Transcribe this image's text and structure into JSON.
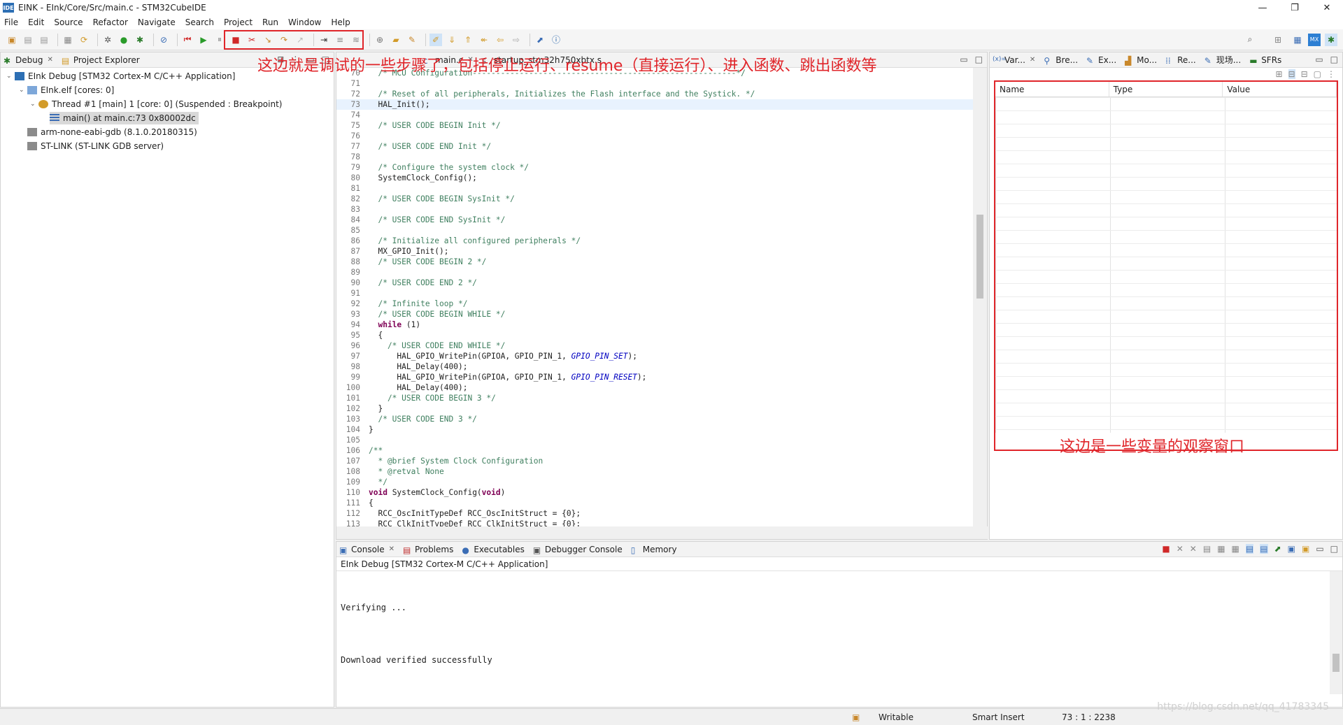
{
  "window": {
    "title": "EINK - EInk/Core/Src/main.c - STM32CubeIDE",
    "logo": "IDE",
    "minimize": "—",
    "maximize": "❐",
    "close": "✕"
  },
  "menu": [
    "File",
    "Edit",
    "Source",
    "Refactor",
    "Navigate",
    "Search",
    "Project",
    "Run",
    "Window",
    "Help"
  ],
  "annotations": {
    "toolbar_note": "这边就是调试的一些步骤了，包括停止运行、resume（直接运行）、进入函数、跳出函数等",
    "variables_note": "这边是一些变量的观察窗口",
    "highlight_color": "#e0252a"
  },
  "debug_panel": {
    "tabs": [
      "Debug",
      "Project Explorer"
    ],
    "tree": [
      {
        "label": "EInk Debug [STM32 Cortex-M C/C++ Application]",
        "icon": "ide-icon"
      },
      {
        "label": "EInk.elf [cores: 0]",
        "icon": "process-icon"
      },
      {
        "label": "Thread #1 [main] 1 [core: 0] (Suspended : Breakpoint)",
        "icon": "thread-icon"
      },
      {
        "label": "main() at main.c:73 0x80002dc",
        "icon": "stack-frame-icon"
      },
      {
        "label": "arm-none-eabi-gdb (8.1.0.20180315)",
        "icon": "gdb-icon"
      },
      {
        "label": "ST-LINK (ST-LINK GDB server)",
        "icon": "stlink-icon"
      }
    ]
  },
  "editor": {
    "tabs": [
      "main.c",
      "startup_stm32h750xbtx.s"
    ],
    "lines": [
      {
        "n": "70",
        "t": "  /* MCU Configuration--------------------------------------------------------*/",
        "c": "cmt"
      },
      {
        "n": "71",
        "t": "",
        "c": ""
      },
      {
        "n": "72",
        "t": "  /* Reset of all peripherals, Initializes the Flash interface and the Systick. */",
        "c": "cmt"
      },
      {
        "n": "73",
        "t": "  HAL_Init();",
        "c": "cur"
      },
      {
        "n": "74",
        "t": "",
        "c": ""
      },
      {
        "n": "75",
        "t": "  /* USER CODE BEGIN Init */",
        "c": "cmt"
      },
      {
        "n": "76",
        "t": "",
        "c": ""
      },
      {
        "n": "77",
        "t": "  /* USER CODE END Init */",
        "c": "cmt"
      },
      {
        "n": "78",
        "t": "",
        "c": ""
      },
      {
        "n": "79",
        "t": "  /* Configure the system clock */",
        "c": "cmt"
      },
      {
        "n": "80",
        "t": "  SystemClock_Config();",
        "c": ""
      },
      {
        "n": "81",
        "t": "",
        "c": ""
      },
      {
        "n": "82",
        "t": "  /* USER CODE BEGIN SysInit */",
        "c": "cmt"
      },
      {
        "n": "83",
        "t": "",
        "c": ""
      },
      {
        "n": "84",
        "t": "  /* USER CODE END SysInit */",
        "c": "cmt"
      },
      {
        "n": "85",
        "t": "",
        "c": ""
      },
      {
        "n": "86",
        "t": "  /* Initialize all configured peripherals */",
        "c": "cmt"
      },
      {
        "n": "87",
        "t": "  MX_GPIO_Init();",
        "c": ""
      },
      {
        "n": "88",
        "t": "  /* USER CODE BEGIN 2 */",
        "c": "cmt"
      },
      {
        "n": "89",
        "t": "",
        "c": ""
      },
      {
        "n": "90",
        "t": "  /* USER CODE END 2 */",
        "c": "cmt"
      },
      {
        "n": "91",
        "t": "",
        "c": ""
      },
      {
        "n": "92",
        "t": "  /* Infinite loop */",
        "c": "cmt"
      },
      {
        "n": "93",
        "t": "  /* USER CODE BEGIN WHILE */",
        "c": "cmt"
      },
      {
        "n": "94",
        "t": "  while (1)",
        "c": "kw"
      },
      {
        "n": "95",
        "t": "  {",
        "c": ""
      },
      {
        "n": "96",
        "t": "    /* USER CODE END WHILE */",
        "c": "cmt"
      },
      {
        "n": "97",
        "t": "      HAL_GPIO_WritePin(GPIOA, GPIO_PIN_1, GPIO_PIN_SET);",
        "c": ""
      },
      {
        "n": "98",
        "t": "      HAL_Delay(400);",
        "c": ""
      },
      {
        "n": "99",
        "t": "      HAL_GPIO_WritePin(GPIOA, GPIO_PIN_1, GPIO_PIN_RESET);",
        "c": ""
      },
      {
        "n": "100",
        "t": "      HAL_Delay(400);",
        "c": ""
      },
      {
        "n": "101",
        "t": "    /* USER CODE BEGIN 3 */",
        "c": "cmt"
      },
      {
        "n": "102",
        "t": "  }",
        "c": ""
      },
      {
        "n": "103",
        "t": "  /* USER CODE END 3 */",
        "c": "cmt"
      },
      {
        "n": "104",
        "t": "}",
        "c": ""
      },
      {
        "n": "105",
        "t": "",
        "c": ""
      },
      {
        "n": "106",
        "t": "/**",
        "c": "cmt"
      },
      {
        "n": "107",
        "t": "  * @brief System Clock Configuration",
        "c": "cmt"
      },
      {
        "n": "108",
        "t": "  * @retval None",
        "c": "cmt"
      },
      {
        "n": "109",
        "t": "  */",
        "c": "cmt"
      },
      {
        "n": "110",
        "t": "void SystemClock_Config(void)",
        "c": "kw"
      },
      {
        "n": "111",
        "t": "{",
        "c": ""
      },
      {
        "n": "112",
        "t": "  RCC_OscInitTypeDef RCC_OscInitStruct = {0};",
        "c": ""
      },
      {
        "n": "113",
        "t": "  RCC_ClkInitTypeDef RCC_ClkInitStruct = {0};",
        "c": ""
      }
    ]
  },
  "variables_panel": {
    "tabs": [
      "Var...",
      "Bre...",
      "Ex...",
      "Mo...",
      "Re...",
      "现场...",
      "SFRs"
    ],
    "columns": [
      "Name",
      "Type",
      "Value"
    ]
  },
  "console_panel": {
    "tabs": [
      "Console",
      "Problems",
      "Executables",
      "Debugger Console",
      "Memory"
    ],
    "subtitle": "EInk Debug [STM32 Cortex-M C/C++ Application]",
    "output": [
      "",
      "Verifying ...",
      "",
      "",
      "",
      "",
      "Download verified successfully"
    ]
  },
  "statusbar": {
    "mode": "Writable",
    "insert": "Smart Insert",
    "position": "73 : 1 : 2238"
  },
  "watermark": "https://blog.csdn.net/qq_41783345"
}
